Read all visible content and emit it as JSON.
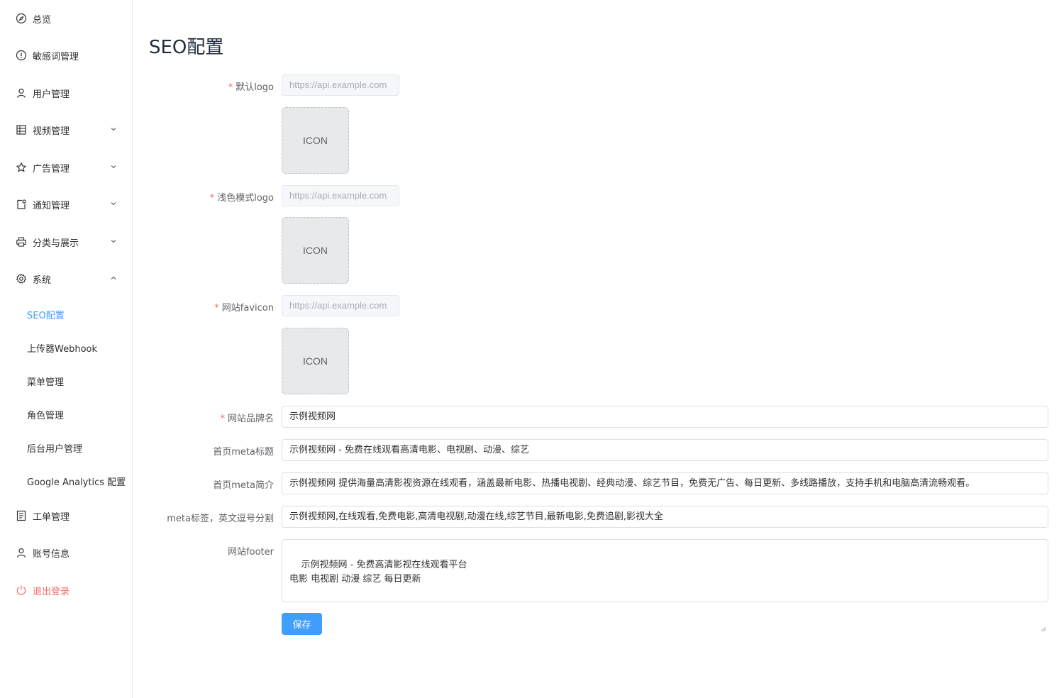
{
  "sidebar": {
    "items": [
      {
        "label": "总览",
        "icon": "compass-icon"
      },
      {
        "label": "敏感词管理",
        "icon": "warning-circle-icon"
      },
      {
        "label": "用户管理",
        "icon": "user-icon"
      },
      {
        "label": "视频管理",
        "icon": "grid-icon"
      },
      {
        "label": "广告管理",
        "icon": "star-icon"
      },
      {
        "label": "通知管理",
        "icon": "notification-icon"
      },
      {
        "label": "分类与展示",
        "icon": "printer-icon"
      },
      {
        "label": "系统",
        "icon": "gear-icon"
      },
      {
        "label": "工单管理",
        "icon": "document-icon"
      },
      {
        "label": "账号信息",
        "icon": "user-icon"
      },
      {
        "label": "退出登录",
        "icon": "power-icon"
      }
    ],
    "system_sub": [
      {
        "label": "SEO配置"
      },
      {
        "label": "上传器Webhook"
      },
      {
        "label": "菜单管理"
      },
      {
        "label": "角色管理"
      },
      {
        "label": "后台用户管理"
      },
      {
        "label": "Google Analytics 配置"
      }
    ]
  },
  "page": {
    "title": "SEO配置"
  },
  "form": {
    "required_mark": "*",
    "default_logo": {
      "label": "默认logo",
      "placeholder": "https://api.example.com",
      "preview": "ICON"
    },
    "light_logo": {
      "label": "浅色模式logo",
      "placeholder": "https://api.example.com",
      "preview": "ICON"
    },
    "favicon": {
      "label": "网站favicon",
      "placeholder": "https://api.example.com",
      "preview": "ICON"
    },
    "brand_name": {
      "label": "网站品牌名",
      "value": "示例视频网"
    },
    "meta_title": {
      "label": "首页meta标题",
      "value": "示例视频网 - 免费在线观看高清电影、电视剧、动漫、综艺"
    },
    "meta_description": {
      "label": "首页meta简介",
      "value": "示例视频网 提供海量高清影视资源在线观看，涵盖最新电影、热播电视剧、经典动漫、综艺节目，免费无广告、每日更新、多线路播放，支持手机和电脑高清流畅观看。"
    },
    "meta_keywords": {
      "label": "meta标签，英文逗号分割",
      "value": "示例视频网,在线观看,免费电影,高清电视剧,动漫在线,综艺节目,最新电影,免费追剧,影视大全"
    },
    "footer": {
      "label": "网站footer",
      "value": "示例视频网 - 免费高清影视在线观看平台\n电影 电视剧 动漫 综艺 每日更新"
    },
    "save_label": "保存"
  },
  "colors": {
    "accent": "#409eff",
    "danger": "#f56c6c"
  }
}
